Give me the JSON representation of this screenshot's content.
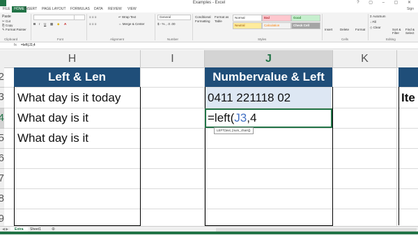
{
  "window": {
    "title": "Examples - Excel",
    "buttons": "? ▢ – ▢ ✕"
  },
  "tabs": [
    {
      "label": "FILE"
    },
    {
      "label": "HOME"
    },
    {
      "label": "INSERT"
    },
    {
      "label": "PAGE LAYOUT"
    },
    {
      "label": "FORMULAS"
    },
    {
      "label": "DATA"
    },
    {
      "label": "REVIEW"
    },
    {
      "label": "VIEW"
    }
  ],
  "user": "Sign",
  "ribbon": {
    "clipboard": {
      "cut": "Cut",
      "copy": "Copy",
      "format_painter": "Format Painter",
      "paste": "Paste",
      "group": "Clipboard"
    },
    "font": {
      "bold": "B",
      "italic": "I",
      "underline": "U",
      "group": "Font"
    },
    "alignment": {
      "wrap": "Wrap Text",
      "merge": "Merge & Center",
      "group": "Alignment"
    },
    "number": {
      "format": "General",
      "symbols": "$ - % , .0 .00",
      "group": "Number"
    },
    "styles": {
      "conditional": "Conditional Formatting",
      "format_table": "Format as Table",
      "normal": "Normal",
      "bad": "Bad",
      "good": "Good",
      "neutral": "Neutral",
      "calculation": "Calculation",
      "check_cell": "Check Cell",
      "group": "Styles"
    },
    "cells": {
      "insert": "Insert",
      "delete": "Delete",
      "format": "Format",
      "group": "Cells"
    },
    "editing": {
      "autosum": "AutoSum",
      "fill": "Fill",
      "clear": "Clear",
      "sort": "Sort & Filter",
      "find": "Find & Select",
      "group": "Editing"
    }
  },
  "formula_bar": {
    "fx": "fx",
    "formula": "=left(J3,4"
  },
  "columns": {
    "h": "H",
    "i": "I",
    "j": "J",
    "k": "K"
  },
  "rows": {
    "r2": "2",
    "r3": "3",
    "r4": "4",
    "r5": "5",
    "r6": "6",
    "r7": "7",
    "r8": "8",
    "r9": "9"
  },
  "cells": {
    "h2": "Left & Len",
    "h3": "What day is it today",
    "h4": "What day is it",
    "h5": "What day is it",
    "j2": "Numbervalue & Left",
    "j3": "0411 221118 02",
    "j4_prefix": "=left(",
    "j4_ref": "J3",
    "j4_suffix": ",4",
    "l3": "Ite"
  },
  "tooltip": "LEFT(text, [num_chars])",
  "sheets": [
    {
      "label": "Extra"
    },
    {
      "label": "Sheet1"
    }
  ],
  "colors": {
    "header_bg": "#1f4e79",
    "selection": "#217346",
    "ref_blue": "#4472c4",
    "j3_fill": "#dde7f3"
  }
}
